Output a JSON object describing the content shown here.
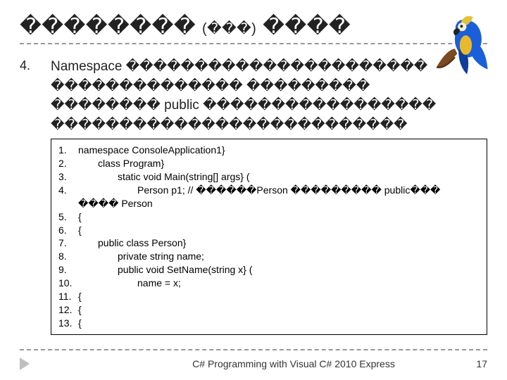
{
  "title_main": "��������",
  "title_sub": "(���)",
  "title_tail": "����",
  "list_number": "4.",
  "para_line1_lead": "Namespace ",
  "para_line1_rest": "����������������������",
  "para_line2": "�������������� ���������",
  "para_line3_a": "�������� ",
  "para_line3_kw": "public ",
  "para_line3_b": "�����������������",
  "para_line4": "��������������������������",
  "code": {
    "l1": "namespace ConsoleApplication1}",
    "l2": "class Program}",
    "l3": "static void Main(string[] args}   (",
    "l4a": "Person p1; // ������",
    "l4b": "Person",
    "l4c": " ��������� ",
    "l4d": "public",
    "l4e": "���",
    "l4f": "����",
    "l4g": "Person",
    "l5": "{",
    "l6": "{",
    "l7": "public class Person}",
    "l8": "private string name;",
    "l9": "public void SetName(string x}   (",
    "l10": "name = x;",
    "l11": "{",
    "l12": "{",
    "l13": "{"
  },
  "footer_text": "C# Programming with Visual C# 2010 Express",
  "page_number": "17"
}
